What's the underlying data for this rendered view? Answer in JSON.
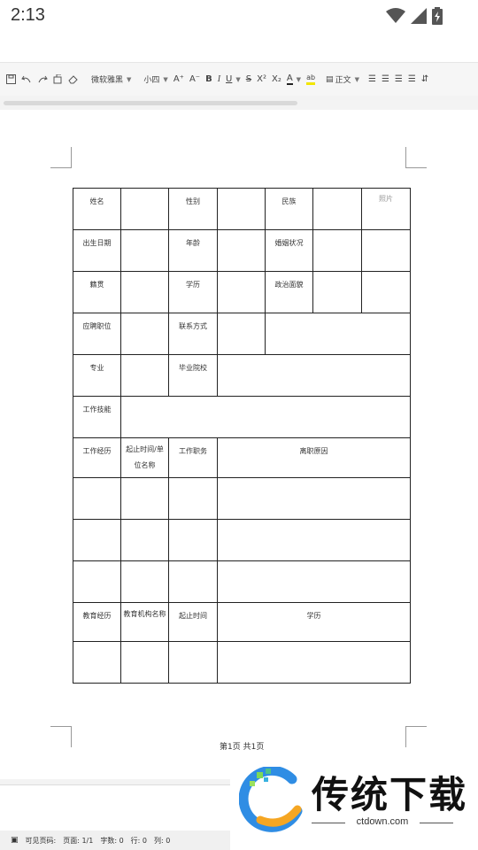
{
  "status": {
    "time": "2:13"
  },
  "toolbar": {
    "font_name": "微软雅黑",
    "font_size": "小四",
    "para_style": "正文",
    "bold": "B",
    "italic": "I",
    "underline": "U",
    "strike": "S",
    "superscript": "X²",
    "subscript": "X₂",
    "font_color": "A",
    "highlight": "ab",
    "grow_font": "A⁺",
    "shrink_font": "A⁻"
  },
  "table": {
    "r1": {
      "name": "姓名",
      "gender": "性别",
      "ethnic": "民族",
      "photo": "照片"
    },
    "r2": {
      "birth": "出生日期",
      "age": "年龄",
      "marital": "婚姻状况"
    },
    "r3": {
      "native": "籍贯",
      "edu": "学历",
      "political": "政治面貌"
    },
    "r4": {
      "position": "应聘职位",
      "contact": "联系方式"
    },
    "r5": {
      "major": "专业",
      "school": "毕业院校"
    },
    "r6": {
      "skills": "工作技能"
    },
    "r7": {
      "work": "工作经历",
      "period_unit": "起止时间/单位名称",
      "duty": "工作职务",
      "leave": "离职原因"
    },
    "r8": {
      "education": "教育经历",
      "institution": "教育机构名称",
      "period": "起止时间",
      "degree": "学历"
    }
  },
  "page_footer": "第1页 共1页",
  "statusline": {
    "visible_pages": "可见页码:",
    "pages": "页面: 1/1",
    "words": "字数: 0",
    "line": "行: 0",
    "col": "列: 0"
  },
  "watermark": {
    "title": "传统下载",
    "url": "ctdown.com"
  }
}
